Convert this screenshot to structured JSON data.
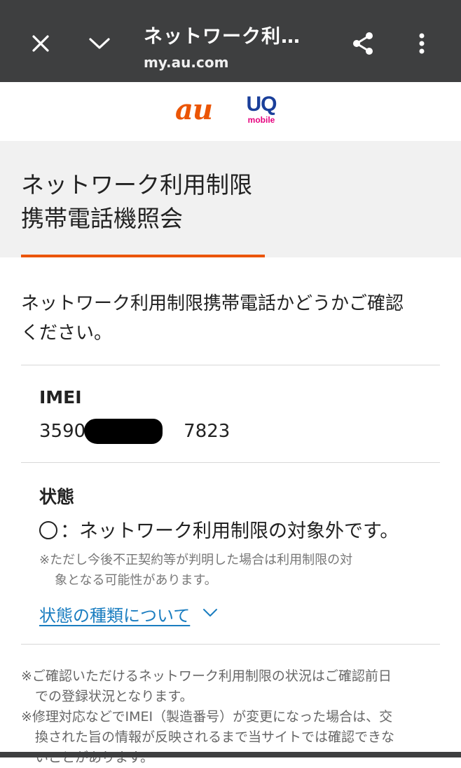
{
  "browser": {
    "title": "ネットワーク利…",
    "url": "my.au.com",
    "icons": [
      "close-icon",
      "chevron-down-icon",
      "share-icon",
      "more-vert-icon"
    ]
  },
  "logos": {
    "au": "au",
    "uq": "UQ",
    "uq_sub": "mobile",
    "colors": {
      "au": "#eb5505",
      "uq": "#1a3f9a",
      "uq_sub": "#e6007e"
    }
  },
  "header": {
    "line1": "ネットワーク利用制限",
    "line2": "携帯電話機照会",
    "accent_color": "#eb5505"
  },
  "intro": {
    "line1": "ネットワーク利用制限携帯電話かどうかご確認",
    "line2": "ください。"
  },
  "imei": {
    "label": "IMEI",
    "value_start": "3590",
    "value_end": "7823"
  },
  "status": {
    "label": "状態",
    "symbol": "◯",
    "text": "：ネットワーク利用制限の対象外です。",
    "note_line1": "※ただし今後不正契約等が判明した場合は利用制限の対",
    "note_line2": "象となる可能性があります。",
    "link_text": "状態の種類について",
    "link_color": "#1a7dc0"
  },
  "footer": {
    "line1": "※ご確認いただけるネットワーク利用制限の状況はご確認前日",
    "line2": "での登録状況となります。",
    "line3": "※修理対応などでIMEI（製造番号）が変更になった場合は、交",
    "line4": "換された旨の情報が反映されるまで当サイトでは確認できな",
    "line5": "いことがあります。"
  }
}
